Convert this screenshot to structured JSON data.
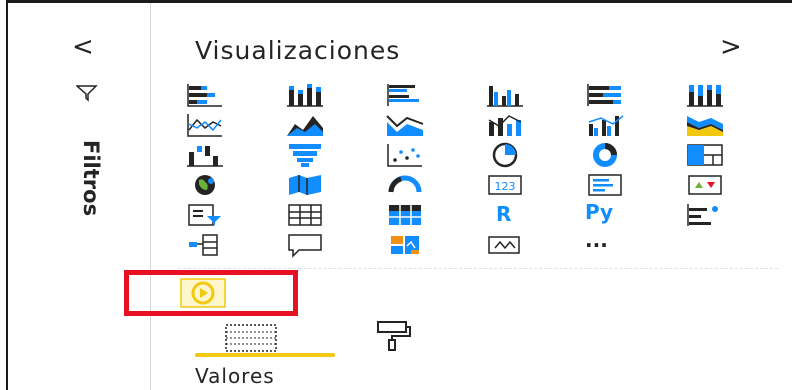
{
  "filters_pane": {
    "collapse_glyph": "<",
    "label": "Filtros"
  },
  "visualizations_pane": {
    "title": "Visualizaciones",
    "expand_glyph": ">",
    "text_visuals": {
      "r": "R",
      "python": "Py",
      "more": "..."
    }
  },
  "fields_section": {
    "label": "Valores"
  },
  "colors": {
    "accent_blue": "#118dff",
    "accent_yellow": "#f2c811",
    "highlight_red": "#e81123",
    "text": "#252423"
  }
}
